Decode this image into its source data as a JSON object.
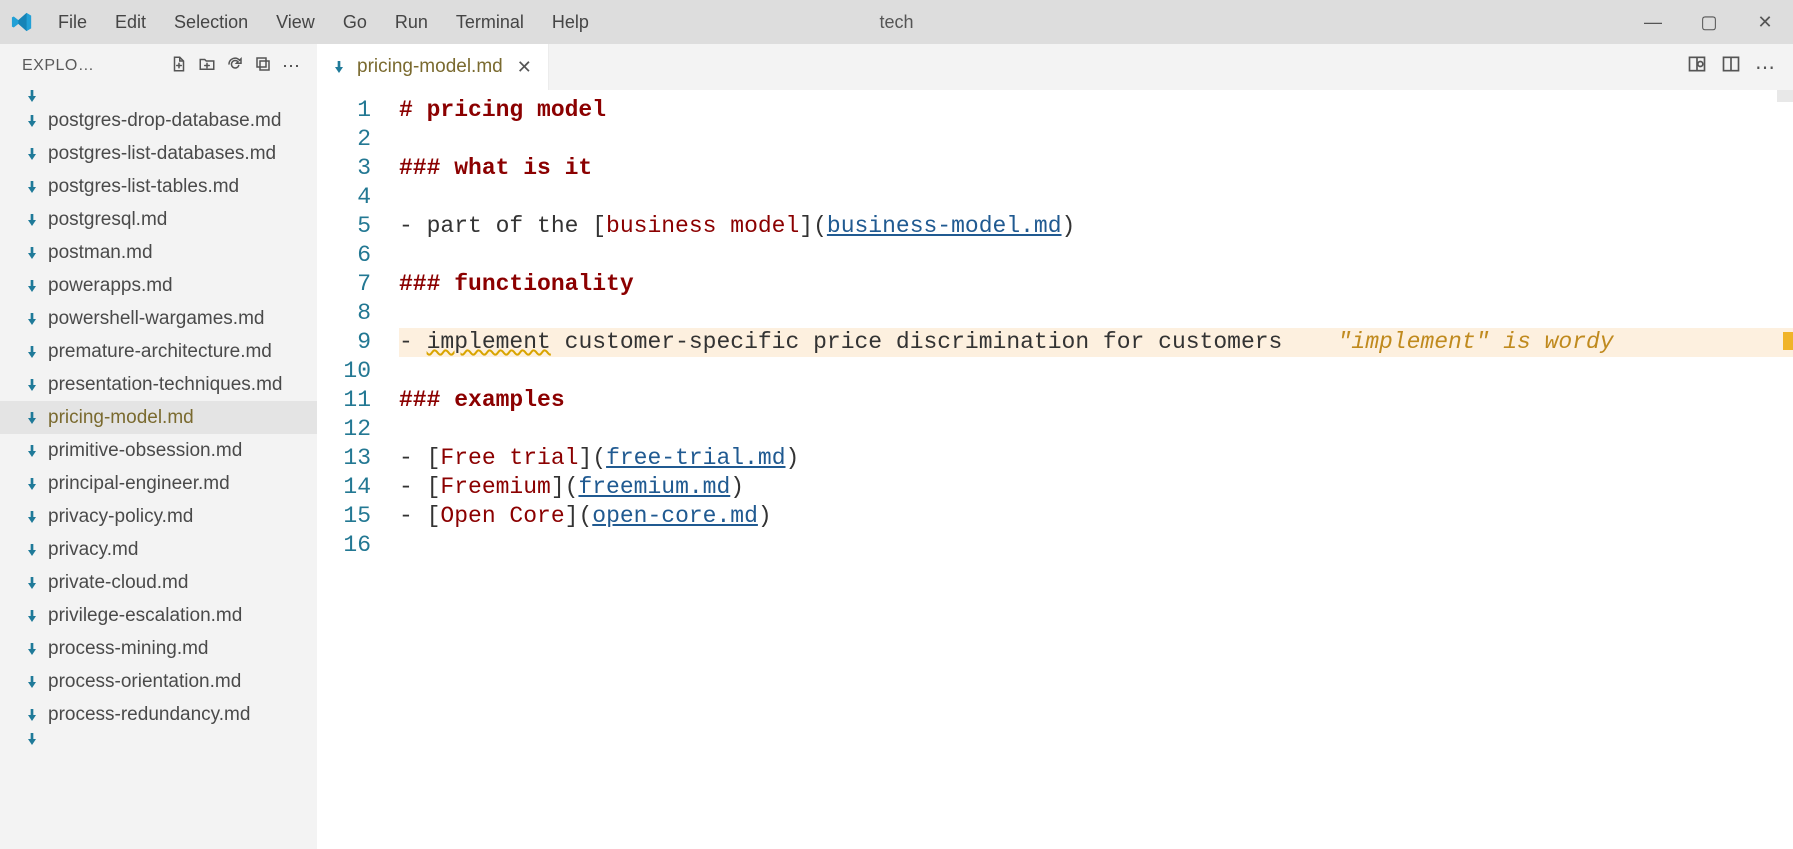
{
  "titlebar": {
    "menu": [
      "File",
      "Edit",
      "Selection",
      "View",
      "Go",
      "Run",
      "Terminal",
      "Help"
    ],
    "title": "tech"
  },
  "sidebar": {
    "header": "EXPLO…",
    "header_icons": [
      "new-file",
      "new-folder",
      "refresh",
      "collapse",
      "more"
    ],
    "files": [
      {
        "name": "postgres-drop-database.md",
        "active": false
      },
      {
        "name": "postgres-list-databases.md",
        "active": false
      },
      {
        "name": "postgres-list-tables.md",
        "active": false
      },
      {
        "name": "postgresql.md",
        "active": false
      },
      {
        "name": "postman.md",
        "active": false
      },
      {
        "name": "powerapps.md",
        "active": false
      },
      {
        "name": "powershell-wargames.md",
        "active": false
      },
      {
        "name": "premature-architecture.md",
        "active": false
      },
      {
        "name": "presentation-techniques.md",
        "active": false
      },
      {
        "name": "pricing-model.md",
        "active": true
      },
      {
        "name": "primitive-obsession.md",
        "active": false
      },
      {
        "name": "principal-engineer.md",
        "active": false
      },
      {
        "name": "privacy-policy.md",
        "active": false
      },
      {
        "name": "privacy.md",
        "active": false
      },
      {
        "name": "private-cloud.md",
        "active": false
      },
      {
        "name": "privilege-escalation.md",
        "active": false
      },
      {
        "name": "process-mining.md",
        "active": false
      },
      {
        "name": "process-orientation.md",
        "active": false
      },
      {
        "name": "process-redundancy.md",
        "active": false
      }
    ]
  },
  "tab": {
    "label": "pricing-model.md"
  },
  "editor": {
    "line_numbers": [
      "1",
      "2",
      "3",
      "4",
      "5",
      "6",
      "7",
      "8",
      "9",
      "10",
      "11",
      "12",
      "13",
      "14",
      "15",
      "16"
    ],
    "lines": {
      "l1_h1": "# pricing model",
      "l3_h3": "### what is it",
      "l5_pre": "- part of the [",
      "l5_link_text": "business model",
      "l5_mid": "](",
      "l5_link_href": "business-model.md",
      "l5_post": ")",
      "l7_h3": "### functionality",
      "l9_pre": "- ",
      "l9_word": "implement",
      "l9_rest": " customer-specific price discrimination for customers",
      "l9_hint_gap": "    ",
      "l9_hint": "\"implement\" is wordy ",
      "l11_h3": "### examples",
      "l13_pre": "- [",
      "l13_text": "Free trial",
      "l13_mid": "](",
      "l13_href": "free-trial.md",
      "l13_post": ")",
      "l14_pre": "- [",
      "l14_text": "Freemium",
      "l14_mid": "](",
      "l14_href": "freemium.md",
      "l14_post": ")",
      "l15_pre": "- [",
      "l15_text": "Open Core",
      "l15_mid": "](",
      "l15_href": "open-core.md",
      "l15_post": ")"
    }
  }
}
